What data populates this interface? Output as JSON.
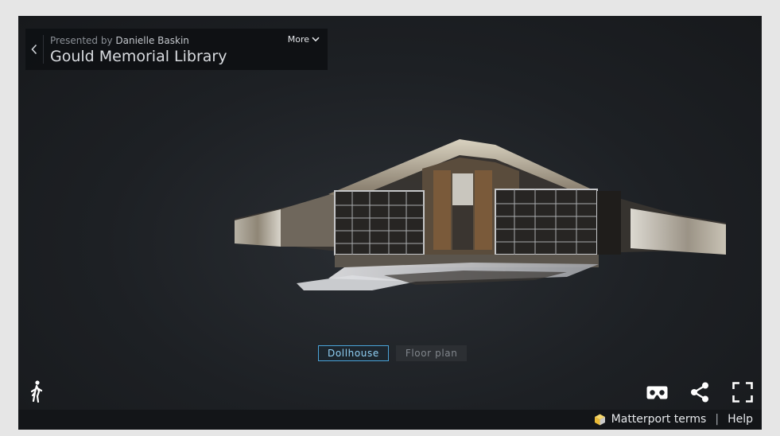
{
  "header": {
    "presented_prefix": "Presented by",
    "presenter": "Danielle Baskin",
    "title": "Gould Memorial Library",
    "more_label": "More"
  },
  "viewer": {
    "view_modes": [
      {
        "label": "Dollhouse",
        "active": true
      },
      {
        "label": "Floor plan",
        "active": false
      }
    ]
  },
  "controls": {
    "walk_icon": "walk-icon",
    "vr_icon": "vr-headset-icon",
    "share_icon": "share-icon",
    "fullscreen_icon": "fullscreen-icon"
  },
  "footer": {
    "terms_label": "Matterport terms",
    "separator": "|",
    "help_label": "Help"
  },
  "colors": {
    "active_accent": "#4aa3d9",
    "background": "#1d2024"
  }
}
